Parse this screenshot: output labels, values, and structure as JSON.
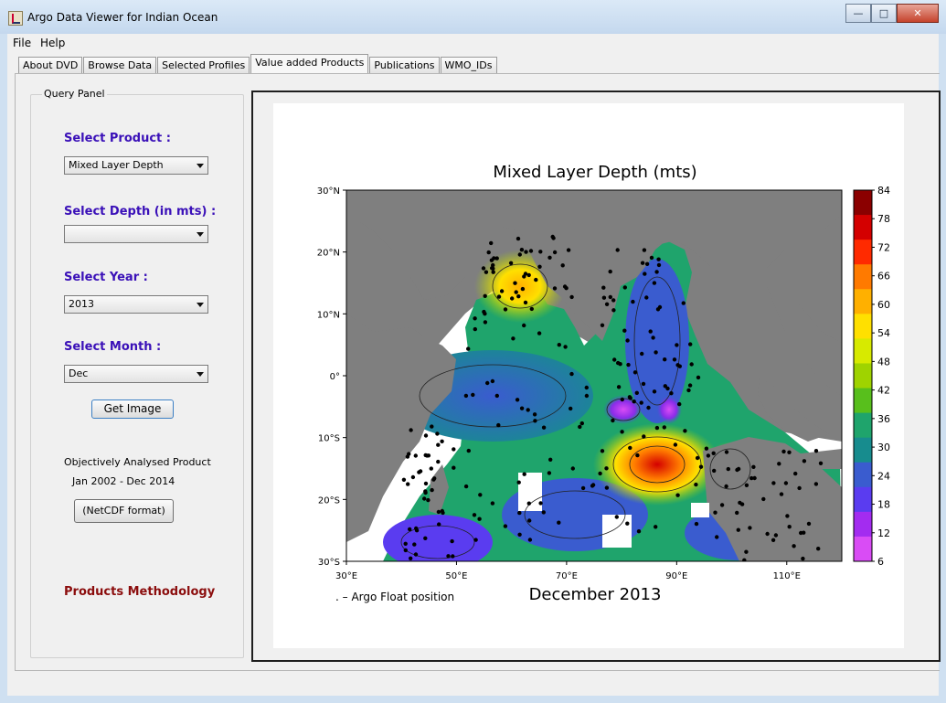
{
  "window": {
    "title": "Argo Data Viewer for Indian Ocean"
  },
  "menu": [
    "File",
    "Help"
  ],
  "tabs": [
    "About DVD",
    "Browse Data",
    "Selected Profiles",
    "Value added Products",
    "Publications",
    "WMO_IDs"
  ],
  "active_tab": "Value added Products",
  "query_panel": {
    "title": "Query Panel",
    "product_label": "Select Product :",
    "product_value": "Mixed Layer Depth",
    "depth_label": "Select Depth (in mts) :",
    "depth_value": "",
    "year_label": "Select Year :",
    "year_value": "2013",
    "month_label": "Select Month :",
    "month_value": "Dec",
    "get_image_label": "Get Image",
    "objective_label": "Objectively Analysed Product",
    "date_range": "Jan 2002 - Dec 2014",
    "netcdf_label": "(NetCDF format)",
    "methodology_label": "Products Methodology"
  },
  "chart_data": {
    "type": "heatmap",
    "title": "Mixed Layer Depth (mts)",
    "subtitle": "December 2013",
    "legend_note": ". – Argo Float position",
    "x_ticks": [
      "30°E",
      "50°E",
      "70°E",
      "90°E",
      "110°E"
    ],
    "y_ticks": [
      "30°N",
      "20°N",
      "10°N",
      "0°",
      "10°S",
      "20°S",
      "30°S"
    ],
    "xlim": [
      30,
      120
    ],
    "ylim": [
      -30,
      30
    ],
    "colorbar": {
      "ticks": [
        "84",
        "78",
        "72",
        "66",
        "60",
        "54",
        "48",
        "42",
        "36",
        "30",
        "24",
        "18",
        "12",
        "6"
      ],
      "colors": [
        "#8b0000",
        "#d40000",
        "#ff2a00",
        "#ff7a00",
        "#ffb000",
        "#ffe000",
        "#d7ea00",
        "#9fd300",
        "#58bf1c",
        "#1fa46c",
        "#178c8e",
        "#3a5ccf",
        "#5a3cf0",
        "#a32cf0",
        "#d94cf5"
      ]
    },
    "land_color": "#7f7f7f"
  }
}
